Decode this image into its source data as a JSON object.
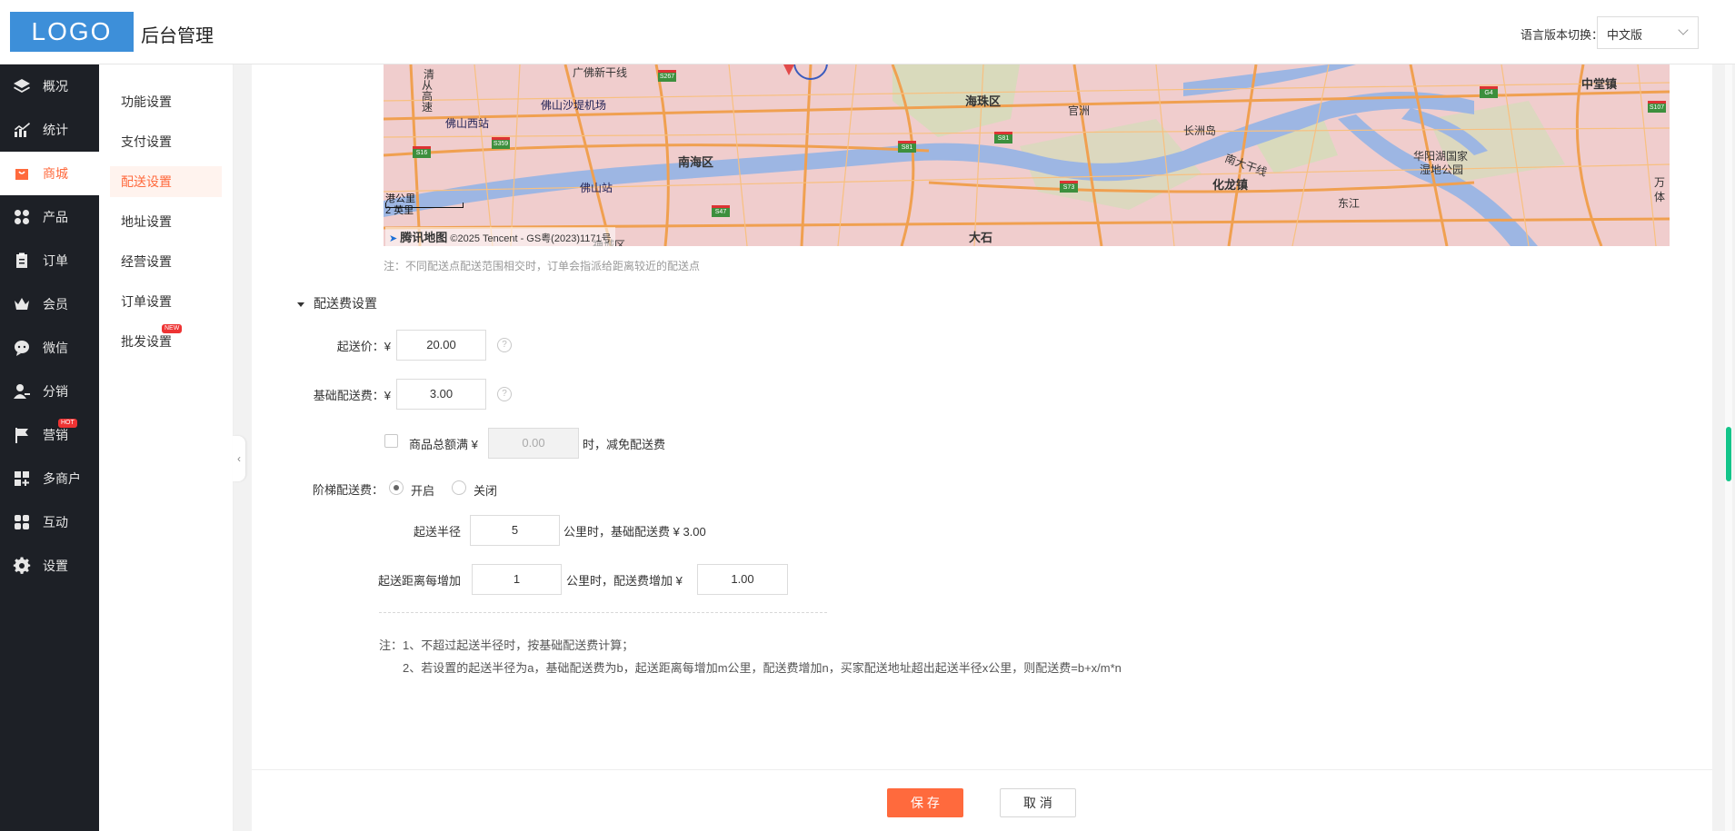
{
  "header": {
    "logo": "LOGO",
    "title": "后台管理",
    "lang_label": "语言版本切换：",
    "lang_value": "中文版"
  },
  "sidebar": {
    "items": [
      {
        "label": "概况",
        "icon": "layers-icon"
      },
      {
        "label": "统计",
        "icon": "chart-icon"
      },
      {
        "label": "商城",
        "icon": "shop-icon",
        "active": true
      },
      {
        "label": "产品",
        "icon": "grid-icon"
      },
      {
        "label": "订单",
        "icon": "clipboard-icon"
      },
      {
        "label": "会员",
        "icon": "crown-icon"
      },
      {
        "label": "微信",
        "icon": "wechat-icon"
      },
      {
        "label": "分销",
        "icon": "user-share-icon"
      },
      {
        "label": "营销",
        "icon": "flag-icon",
        "badge": "HOT"
      },
      {
        "label": "多商户",
        "icon": "store-add-icon"
      },
      {
        "label": "互动",
        "icon": "users-icon"
      },
      {
        "label": "设置",
        "icon": "gear-icon"
      }
    ]
  },
  "subnav": {
    "items": [
      {
        "label": "功能设置"
      },
      {
        "label": "支付设置"
      },
      {
        "label": "配送设置",
        "active": true
      },
      {
        "label": "地址设置"
      },
      {
        "label": "经营设置"
      },
      {
        "label": "订单设置"
      },
      {
        "label": "批发设置",
        "badge": "NEW"
      }
    ]
  },
  "map": {
    "labels": [
      "清",
      "从",
      "高",
      "速",
      "广佛新干线",
      "佛山西站",
      "佛山沙堤机场",
      "佛山站",
      "南海区",
      "海珠区",
      "官洲",
      "长洲岛",
      "化龙镇",
      "南大干线",
      "华阳湖国家",
      "湿地公园",
      "东江",
      "中堂镇",
      "万",
      "体",
      "大石",
      "禅城区"
    ],
    "signs": [
      "S267",
      "S16",
      "S359",
      "S81",
      "S81",
      "S73",
      "S47",
      "G4",
      "S107"
    ],
    "scale_top": "公里",
    "scale_bottom": "2 英里",
    "scale_prefix": "港",
    "credit_brand": "腾讯地图",
    "credit_text": "©2025 Tencent - GS粤(2023)1171号"
  },
  "delivery": {
    "note": "注：不同配送点配送范围相交时，订单会指派给距离较近的配送点",
    "section_title": "配送费设置",
    "min_price_label": "起送价：",
    "currency": "¥",
    "min_price_value": "20.00",
    "base_fee_label": "基础配送费：",
    "base_fee_value": "3.00",
    "free_label": "商品总额满 ¥",
    "free_value": "0.00",
    "free_suffix": "时，减免配送费",
    "tier_label": "阶梯配送费：",
    "tier_on": "开启",
    "tier_off": "关闭",
    "radius_label": "起送半径",
    "radius_value": "5",
    "radius_suffix": "公里时，基础配送费 ¥  3.00",
    "step_label": "起送距离每增加",
    "step_value": "1",
    "step_mid": "公里时，配送费增加 ¥",
    "step_fee_value": "1.00",
    "note_line1": "注：1、不超过起送半径时，按基础配送费计算；",
    "note_line2": "2、若设置的起送半径为a，基础配送费为b，起送距离每增加m公里，配送费增加n，买家配送地址超出起送半径x公里，则配送费=b+x/m*n"
  },
  "actions": {
    "save": "保 存",
    "cancel": "取 消"
  },
  "colors": {
    "accent": "#ff6a3d",
    "sidebar_bg": "#1d2026",
    "logo_bg": "#3d8fd9"
  }
}
